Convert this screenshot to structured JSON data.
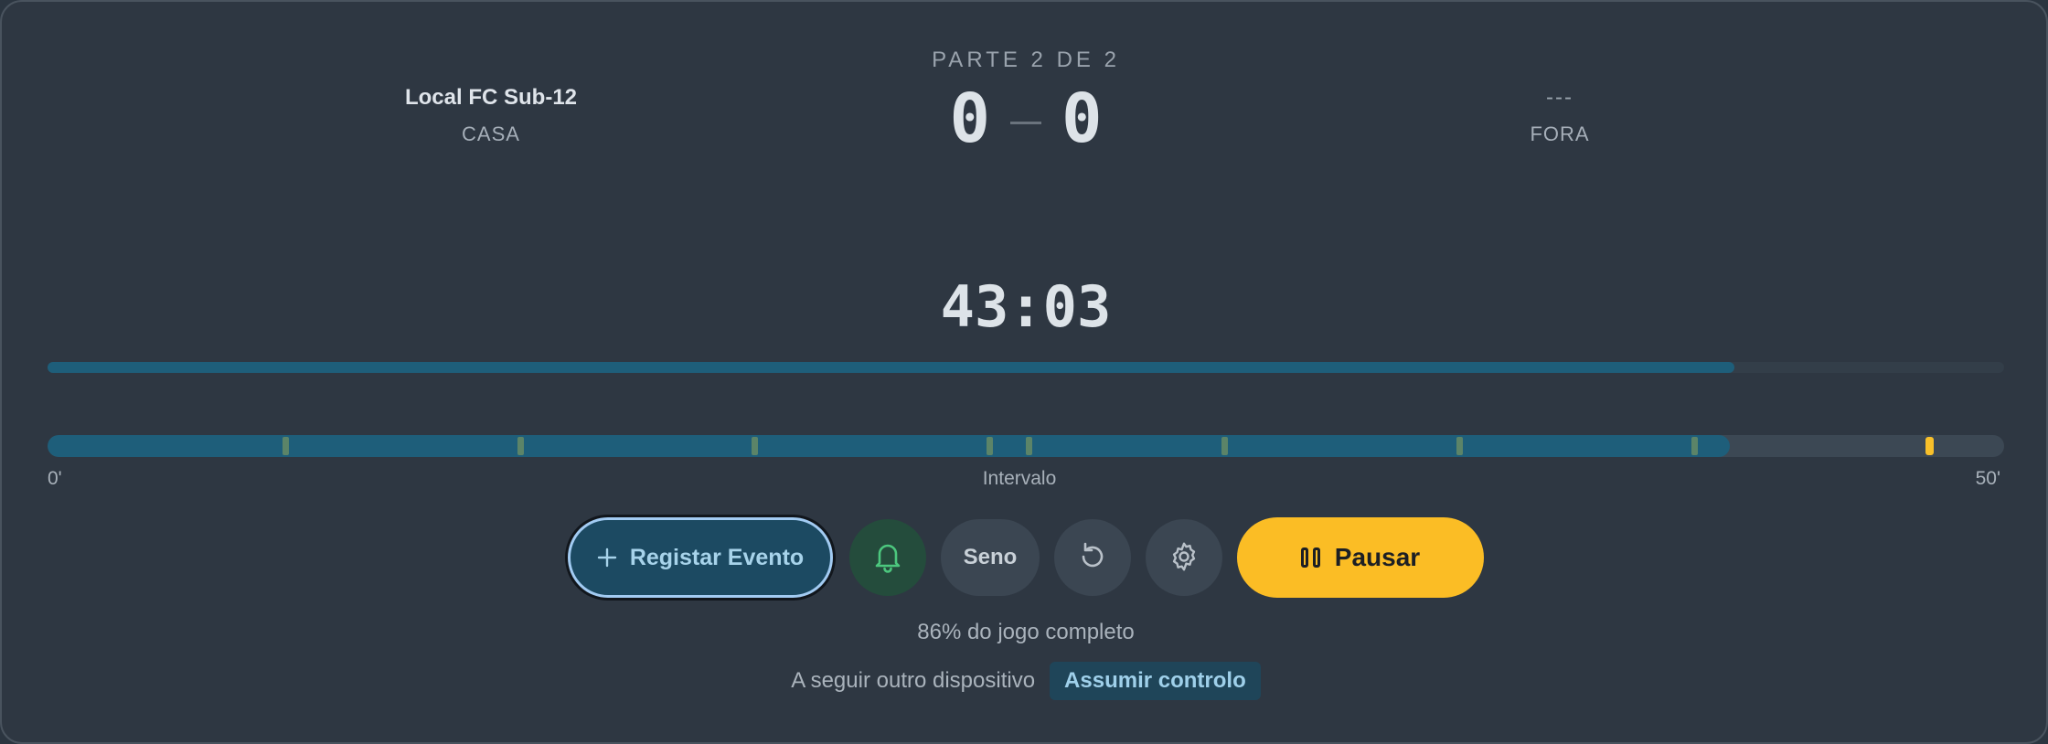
{
  "home": {
    "name": "Local FC Sub-12",
    "side": "CASA"
  },
  "away": {
    "name": "---",
    "side": "FORA"
  },
  "period_label": "PARTE 2 DE 2",
  "score": {
    "home": "0",
    "away": "0"
  },
  "clock": "43:03",
  "progress_fraction": 0.862,
  "timeline": {
    "start_label": "0'",
    "mid_label": "Intervalo",
    "end_label": "50'",
    "elapsed_fraction": 0.86,
    "event_marker_minutes": [
      6,
      12,
      18,
      24,
      25,
      30,
      36,
      42
    ],
    "current_marker_minute": 48,
    "total_minutes": 50,
    "event_color": "#5c8468",
    "current_color": "#f8c02a"
  },
  "controls": {
    "register_label": "Registar Evento",
    "register_icon": "plus-icon",
    "bell_icon": "bell-icon",
    "seno_label": "Seno",
    "undo_icon": "undo-icon",
    "settings_icon": "gear-icon",
    "pause_label": "Pausar",
    "pause_icon": "pause-icon"
  },
  "completion_text": "86% do jogo completo",
  "follow": {
    "text": "A seguir outro dispositivo",
    "takeover_label": "Assumir controlo"
  },
  "colors": {
    "accent": "#1e5e7a",
    "pause_button": "#fbbd25",
    "bell_icon": "#4cc77e"
  }
}
